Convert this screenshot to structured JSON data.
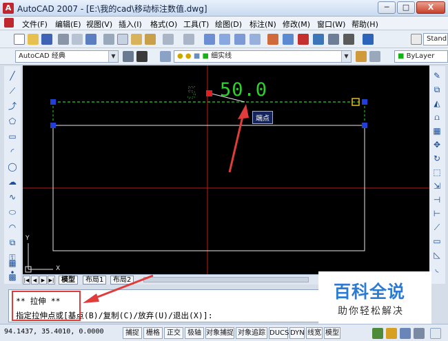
{
  "window": {
    "app_icon_letter": "A",
    "title": "AutoCAD 2007 - [E:\\我的cad\\移动标注数值.dwg]",
    "buttons": {
      "minimize": "─",
      "maximize": "□",
      "close": "X"
    }
  },
  "menu": [
    "文件(F)",
    "编辑(E)",
    "视图(V)",
    "插入(I)",
    "格式(O)",
    "工具(T)",
    "绘图(D)",
    "标注(N)",
    "修改(M)",
    "窗口(W)",
    "帮助(H)"
  ],
  "toolbar": {
    "workspace": "AutoCAD 经典",
    "linetype": "细实线",
    "color": "ByLayer",
    "text_style": "Stand"
  },
  "drawing": {
    "dimension_text": "50.0",
    "tooltip": "端点",
    "ucs_x": "X",
    "ucs_y": "Y"
  },
  "tabs": [
    "模型",
    "布局1",
    "布局2"
  ],
  "command": {
    "line1": "** 拉伸 **",
    "line2_prefix": "指定拉伸点或",
    "line2_rest": "[基点(B)/复制(C)/放弃(U)/退出(X)]:"
  },
  "status": {
    "coordinates": "94.1437,  35.4010, 0.0000",
    "toggles": [
      "捕捉",
      "栅格",
      "正交",
      "极轴",
      "对象捕捉",
      "对象追踪",
      "DUCS",
      "DYN",
      "线宽",
      "模型"
    ]
  },
  "watermark": {
    "title": "百科全说",
    "subtitle": "助你轻松解决"
  },
  "colors": {
    "canvas": "#000000",
    "crosshair": "#c81818",
    "grip": "#1f3fd6",
    "selection": "#2fcf2f",
    "annotation": "#e03c3c",
    "watermark_blue": "#2b7bd3"
  }
}
